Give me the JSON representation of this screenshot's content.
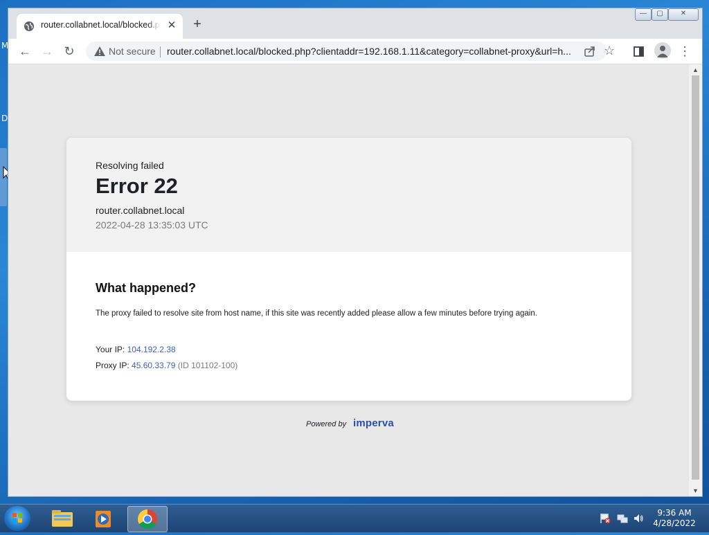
{
  "desktop": {
    "fragments": [
      "M",
      "D"
    ]
  },
  "browser": {
    "tab": {
      "title": "router.collabnet.local/blocked.php",
      "close_glyph": "✕",
      "icon": "globe-icon"
    },
    "new_tab_glyph": "+",
    "window_controls": {
      "minimize": "—",
      "maximize": "▢",
      "close": "✕"
    },
    "toolbar": {
      "back_glyph": "←",
      "forward_glyph": "→",
      "reload_glyph": "↻",
      "security_label": "Not secure",
      "url": "router.collabnet.local/blocked.php?clientaddr=192.168.1.11&category=collabnet-proxy&url=h...",
      "star_glyph": "☆",
      "menu_glyph": "⋮"
    }
  },
  "page": {
    "header": {
      "subtitle": "Resolving failed",
      "title": "Error 22",
      "host": "router.collabnet.local",
      "timestamp": "2022-04-28 13:35:03 UTC"
    },
    "body": {
      "heading": "What happened?",
      "description": "The proxy failed to resolve site from host name, if this site was recently added please allow a few minutes before trying again.",
      "your_ip_label": "Your IP: ",
      "your_ip": "104.192.2.38",
      "proxy_ip_label": "Proxy IP: ",
      "proxy_ip": "45.60.33.79",
      "proxy_id": " (ID 101102-100)"
    },
    "footer": {
      "powered_by": "Powered by",
      "brand": "imperva"
    },
    "colors": {
      "link": "#3b63b5",
      "brand": "#2a4fa6",
      "page_bg": "#e8e8e8"
    }
  },
  "taskbar": {
    "clock_time": "9:36 AM",
    "clock_date": "4/28/2022",
    "items": [
      "start-orb",
      "file-explorer",
      "media-player",
      "chrome"
    ]
  }
}
